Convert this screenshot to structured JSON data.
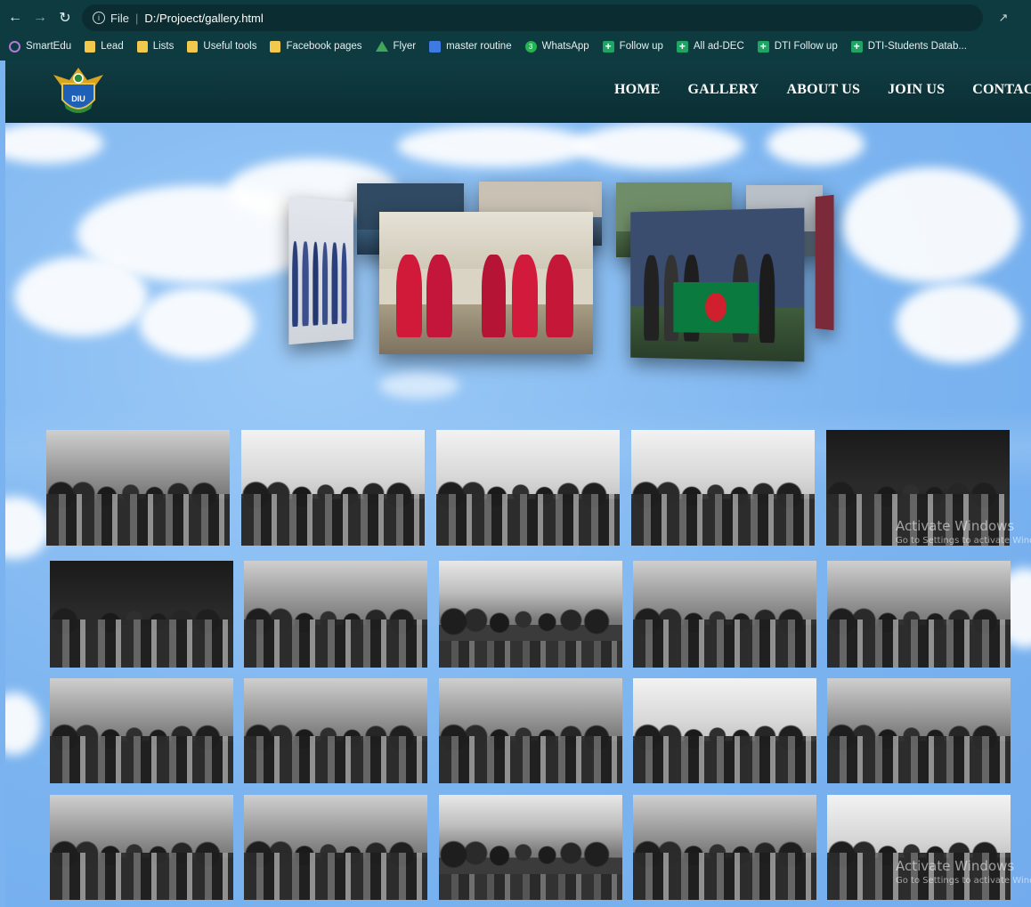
{
  "browser": {
    "url_prefix": "File",
    "url": "D:/Projoect/gallery.html",
    "bookmarks": [
      {
        "label": "SmartEdu",
        "icon": "ring-icon"
      },
      {
        "label": "Lead",
        "icon": "folder-icon"
      },
      {
        "label": "Lists",
        "icon": "folder-icon"
      },
      {
        "label": "Useful tools",
        "icon": "folder-icon"
      },
      {
        "label": "Facebook pages",
        "icon": "folder-icon"
      },
      {
        "label": "Flyer",
        "icon": "drive-icon"
      },
      {
        "label": "master routine",
        "icon": "docs-icon"
      },
      {
        "label": "WhatsApp",
        "icon": "whatsapp-icon"
      },
      {
        "label": "Follow up",
        "icon": "plus-icon"
      },
      {
        "label": "All ad-DEC",
        "icon": "plus-icon"
      },
      {
        "label": "DTI Follow up",
        "icon": "plus-icon"
      },
      {
        "label": "DTI-Students Datab...",
        "icon": "plus-icon"
      }
    ],
    "whatsapp_badge": "3"
  },
  "site": {
    "logo_text": "DIU",
    "menu": [
      "HOME",
      "GALLERY",
      "ABOUT US",
      "JOIN US",
      "CONTAC"
    ]
  },
  "watermark": {
    "line1": "Activate Windows",
    "line2": "Go to Settings to activate Windows."
  },
  "colors": {
    "chrome_bg": "#0e3b3f",
    "nav_bg": "#0f3c42",
    "hero_sky": "#7ab3ef"
  }
}
